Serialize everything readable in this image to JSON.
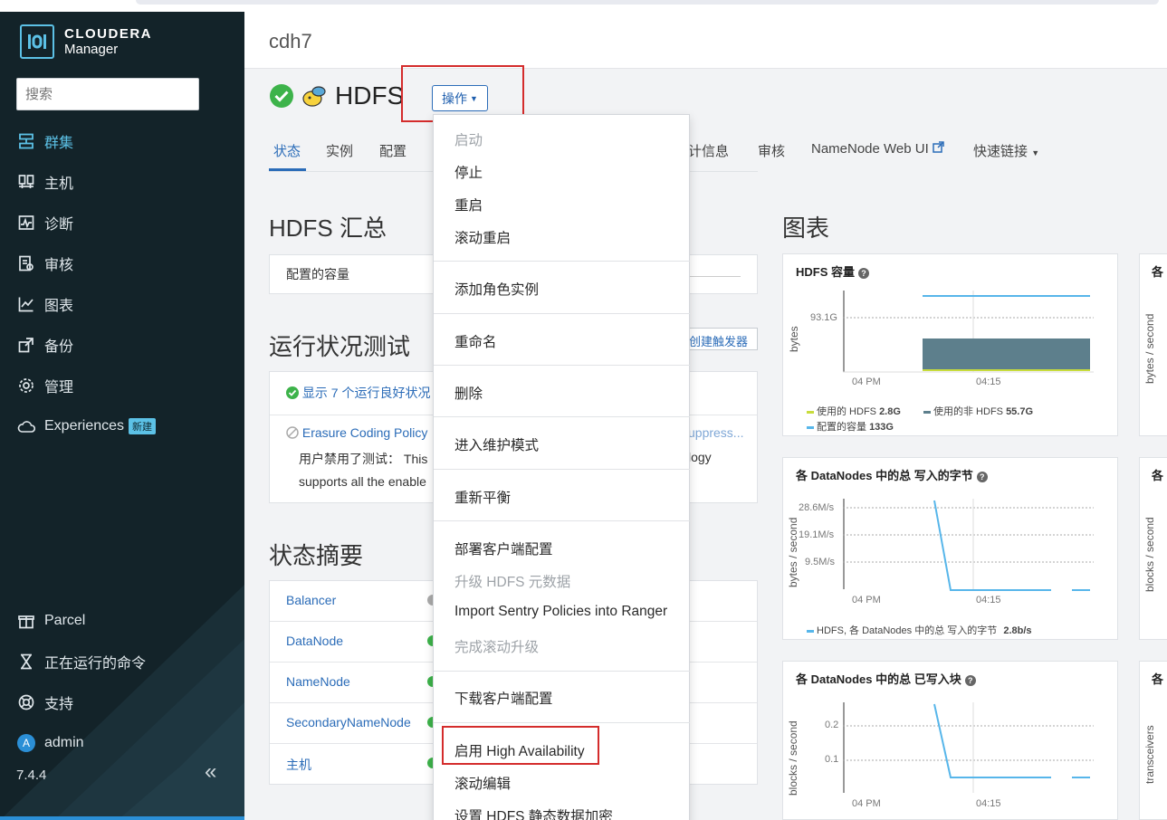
{
  "sidebar": {
    "logo_line1": "CLOUDERA",
    "logo_line2": "Manager",
    "search_placeholder": "搜索",
    "items": [
      {
        "label": "群集",
        "icon": "cluster-icon"
      },
      {
        "label": "主机",
        "icon": "hosts-icon"
      },
      {
        "label": "诊断",
        "icon": "diagnostics-icon"
      },
      {
        "label": "审核",
        "icon": "audit-icon"
      },
      {
        "label": "图表",
        "icon": "charts-icon"
      },
      {
        "label": "备份",
        "icon": "backup-icon"
      },
      {
        "label": "管理",
        "icon": "gear-icon"
      },
      {
        "label": "Experiences",
        "icon": "cloud-icon",
        "badge": "新建"
      }
    ],
    "bottom_items": [
      {
        "label": "Parcel",
        "icon": "parcel-icon"
      },
      {
        "label": "正在运行的命令",
        "icon": "hourglass-icon"
      },
      {
        "label": "支持",
        "icon": "support-icon"
      },
      {
        "label": "admin",
        "icon": "avatar-icon",
        "avatar_letter": "A"
      }
    ],
    "version": "7.4.4",
    "collapse_glyph": "«"
  },
  "header": {
    "cluster_name": "cdh7"
  },
  "service": {
    "name": "HDFS",
    "actions_label": "操作"
  },
  "tabs": [
    {
      "label": "状态"
    },
    {
      "label": "实例"
    },
    {
      "label": "配置"
    },
    {
      "label": "计信息"
    },
    {
      "label": "审核"
    },
    {
      "label": "NameNode Web UI"
    },
    {
      "label": "快速链接"
    }
  ],
  "summary": {
    "title": "HDFS 汇总",
    "configured_capacity_label": "配置的容量"
  },
  "health": {
    "title": "运行状况测试",
    "create_trigger": "创建触发器",
    "good_link": "显示 7 个运行良好状况",
    "erasure_title": "Erasure Coding Policy",
    "suppress": "uppress...",
    "disabled_text_1": "用户禁用了测试： This",
    "disabled_text_2": "logy",
    "disabled_text_3": "supports all the enable"
  },
  "status_summary": {
    "title": "状态摘要",
    "rows": [
      "Balancer",
      "DataNode",
      "NameNode",
      "SecondaryNameNode",
      "主机"
    ]
  },
  "dropdown": {
    "items": [
      {
        "label": "启动",
        "disabled": true
      },
      {
        "label": "停止"
      },
      {
        "label": "重启"
      },
      {
        "label": "滚动重启"
      },
      {
        "label": "添加角色实例"
      },
      {
        "label": "重命名"
      },
      {
        "label": "删除"
      },
      {
        "label": "进入维护模式"
      },
      {
        "label": "重新平衡"
      },
      {
        "label": "部署客户端配置"
      },
      {
        "label": "升级 HDFS 元数据",
        "disabled": true
      },
      {
        "label": "Import Sentry Policies into Ranger"
      },
      {
        "label": "完成滚动升级",
        "disabled": true
      },
      {
        "label": "下载客户端配置"
      },
      {
        "label": "启用 High Availability"
      },
      {
        "label": "滚动编辑"
      },
      {
        "label": "设置 HDFS 静态数据加密"
      }
    ]
  },
  "charts_section": {
    "title": "图表"
  },
  "charts": [
    {
      "title": "HDFS 容量",
      "ylabel": "bytes",
      "y_tick": "93.1G",
      "x_ticks": [
        "04 PM",
        "04:15"
      ],
      "legend": [
        {
          "name": "使用的 HDFS",
          "value": "2.8G",
          "color": "#c8dc3c"
        },
        {
          "name": "使用的非 HDFS",
          "value": "55.7G",
          "color": "#5d7f8c"
        },
        {
          "name": "配置的容量",
          "value": "133G",
          "color": "#57b6ea"
        }
      ]
    },
    {
      "title": "各 DataNodes 中的总 写入的字节",
      "ylabel": "bytes / second",
      "y_ticks": [
        "28.6M/s",
        "19.1M/s",
        "9.5M/s"
      ],
      "x_ticks": [
        "04 PM",
        "04:15"
      ],
      "legend": [
        {
          "name": "HDFS, 各 DataNodes 中的总 写入的字节",
          "value": "2.8b/s",
          "color": "#57b6ea"
        }
      ]
    },
    {
      "title": "各 DataNodes 中的总 已写入块",
      "ylabel": "blocks / second",
      "y_ticks": [
        "0.2",
        "0.1"
      ],
      "x_ticks": [
        "04 PM",
        "04:15"
      ]
    }
  ],
  "partial_charts": [
    {
      "title": "各",
      "ylabel": "bytes / second"
    },
    {
      "title": "各",
      "ylabel": "blocks / second"
    },
    {
      "title": "各",
      "ylabel": "transceivers"
    }
  ],
  "colors": {
    "accent": "#2b6cb8",
    "sidebar_bg": "#132329",
    "highlight_red": "#d42c2c",
    "ok_green": "#3db34a"
  }
}
